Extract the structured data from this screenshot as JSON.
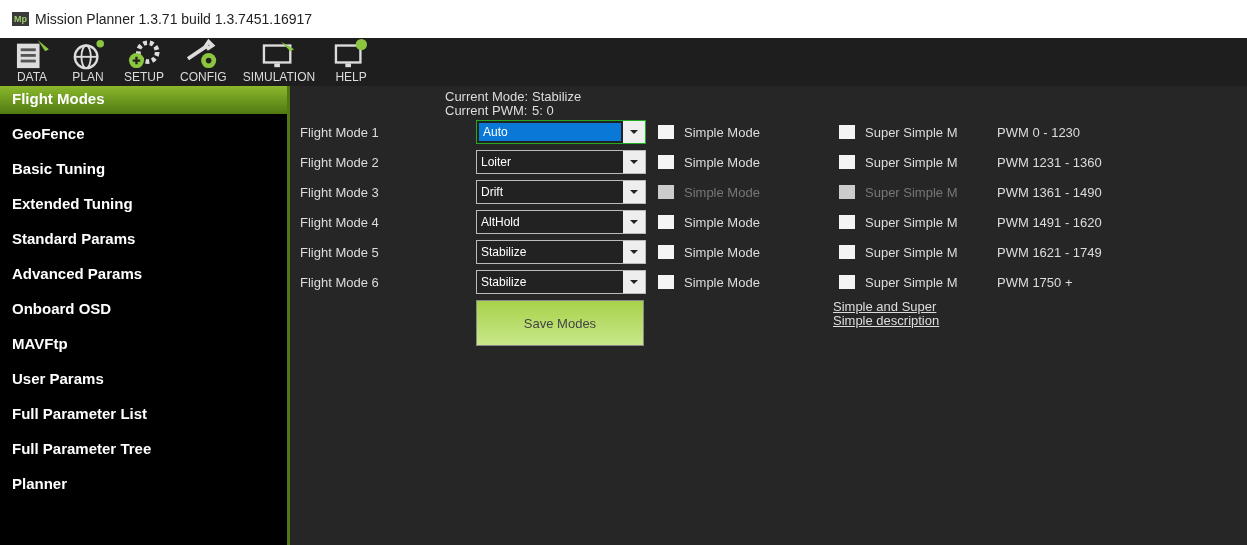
{
  "window": {
    "title": "Mission Planner 1.3.71 build 1.3.7451.16917",
    "logo": "Mp"
  },
  "toolbar": [
    {
      "label": "DATA",
      "kind": "data"
    },
    {
      "label": "PLAN",
      "kind": "plan"
    },
    {
      "label": "SETUP",
      "kind": "setup"
    },
    {
      "label": "CONFIG",
      "kind": "config"
    },
    {
      "label": "SIMULATION",
      "kind": "simulation"
    },
    {
      "label": "HELP",
      "kind": "help"
    }
  ],
  "sidebar": {
    "items": [
      {
        "label": "Flight Modes",
        "selected": true
      },
      {
        "label": "GeoFence",
        "selected": false
      },
      {
        "label": "Basic Tuning",
        "selected": false
      },
      {
        "label": "Extended Tuning",
        "selected": false
      },
      {
        "label": "Standard Params",
        "selected": false
      },
      {
        "label": "Advanced Params",
        "selected": false
      },
      {
        "label": "Onboard OSD",
        "selected": false
      },
      {
        "label": "MAVFtp",
        "selected": false
      },
      {
        "label": "User Params",
        "selected": false
      },
      {
        "label": "Full Parameter List",
        "selected": false
      },
      {
        "label": "Full Parameter Tree",
        "selected": false
      },
      {
        "label": "Planner",
        "selected": false
      }
    ]
  },
  "status": {
    "mode_label": "Current Mode:",
    "mode_value": "Stabilize",
    "pwm_label": "Current PWM:",
    "pwm_value": "5: 0"
  },
  "modes": [
    {
      "label": "Flight Mode 1",
      "value": "Auto",
      "focused": true,
      "simple": "Simple Mode",
      "simple_checked": false,
      "super": "Super Simple M",
      "super_checked": false,
      "disabled": false,
      "pwm": "PWM 0 - 1230"
    },
    {
      "label": "Flight Mode 2",
      "value": "Loiter",
      "focused": false,
      "simple": "Simple Mode",
      "simple_checked": false,
      "super": "Super Simple M",
      "super_checked": false,
      "disabled": false,
      "pwm": "PWM 1231 - 1360"
    },
    {
      "label": "Flight Mode 3",
      "value": "Drift",
      "focused": false,
      "simple": "Simple Mode",
      "simple_checked": false,
      "super": "Super Simple M",
      "super_checked": false,
      "disabled": true,
      "pwm": "PWM 1361 - 1490"
    },
    {
      "label": "Flight Mode 4",
      "value": "AltHold",
      "focused": false,
      "simple": "Simple Mode",
      "simple_checked": false,
      "super": "Super Simple M",
      "super_checked": false,
      "disabled": false,
      "pwm": "PWM 1491 - 1620"
    },
    {
      "label": "Flight Mode 5",
      "value": "Stabilize",
      "focused": false,
      "simple": "Simple Mode",
      "simple_checked": false,
      "super": "Super Simple M",
      "super_checked": false,
      "disabled": false,
      "pwm": "PWM 1621 - 1749"
    },
    {
      "label": "Flight Mode 6",
      "value": "Stabilize",
      "focused": false,
      "simple": "Simple Mode",
      "simple_checked": false,
      "super": "Super Simple M",
      "super_checked": false,
      "disabled": false,
      "pwm": "PWM 1750 +"
    }
  ],
  "save_button": "Save Modes",
  "description_link": "Simple and Super Simple description"
}
